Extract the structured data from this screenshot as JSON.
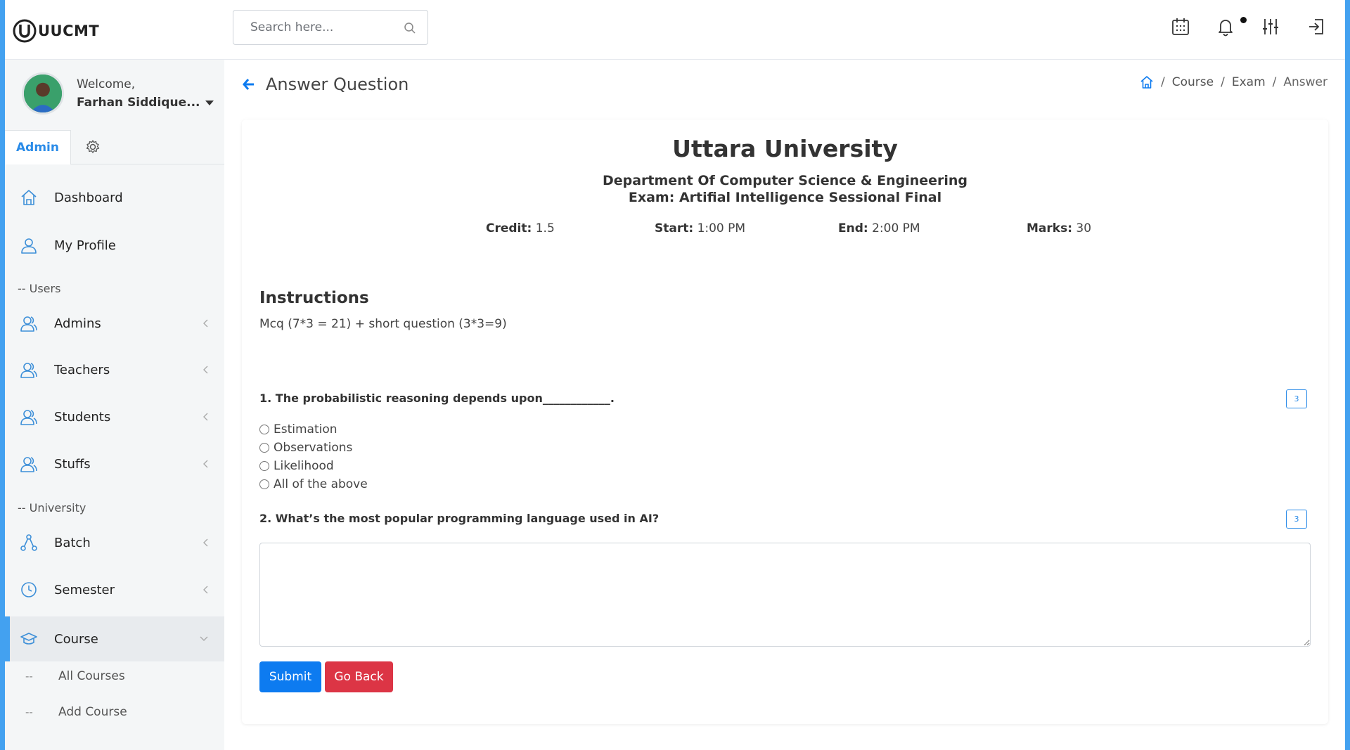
{
  "app": {
    "name": "UUCMT"
  },
  "search": {
    "placeholder": "Search here..."
  },
  "user": {
    "welcome": "Welcome,",
    "name": "Farhan Siddique..."
  },
  "sidebar": {
    "tabs": {
      "admin": "Admin"
    },
    "items": [
      {
        "label": "Dashboard",
        "icon": "home-icon"
      },
      {
        "label": "My Profile",
        "icon": "user-icon"
      },
      {
        "label": "Admins",
        "icon": "users-icon"
      },
      {
        "label": "Teachers",
        "icon": "users-icon"
      },
      {
        "label": "Students",
        "icon": "users-icon"
      },
      {
        "label": "Stuffs",
        "icon": "users-icon"
      },
      {
        "label": "Batch",
        "icon": "share-icon"
      },
      {
        "label": "Semester",
        "icon": "clock-icon"
      },
      {
        "label": "Course",
        "icon": "graduation-cap-icon",
        "active": true
      }
    ],
    "sections": {
      "users": "-- Users",
      "university": "-- University"
    },
    "course_sub": [
      {
        "dash": "--",
        "label": "All Courses"
      },
      {
        "dash": "--",
        "label": "Add Course"
      }
    ]
  },
  "page": {
    "title": "Answer Question"
  },
  "breadcrumb": {
    "items": [
      "Course",
      "Exam",
      "Answer"
    ]
  },
  "exam": {
    "university": "Uttara University",
    "department": "Department Of Computer Science & Engineering",
    "exam_name": "Exam: Artifial Intelligence Sessional Final",
    "credit_label": "Credit:",
    "credit": "1.5",
    "start_label": "Start:",
    "start": "1:00 PM",
    "end_label": "End:",
    "end": "2:00 PM",
    "marks_label": "Marks:",
    "marks": "30",
    "instructions_title": "Instructions",
    "instructions": "Mcq (7*3 = 21) + short question (3*3=9)"
  },
  "questions": [
    {
      "text": "1. The probabilistic reasoning depends upon____________.",
      "marks": "3",
      "options": [
        "Estimation",
        "Observations",
        "Likelihood",
        "All of the above"
      ]
    },
    {
      "text": "2. What’s the most popular programming language used in AI?",
      "marks": "3",
      "answer": ""
    }
  ],
  "buttons": {
    "submit": "Submit",
    "go_back": "Go Back"
  },
  "colors": {
    "accent": "#43a1f0",
    "primary": "#0d7bf0",
    "danger": "#dc3545"
  }
}
